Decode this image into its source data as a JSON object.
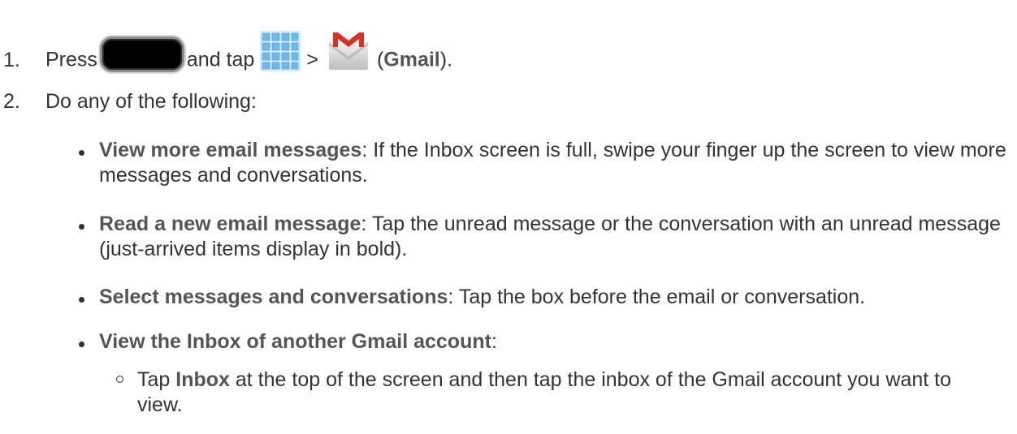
{
  "step1": {
    "number": "1.",
    "press": "Press",
    "and_tap": "and tap",
    "gt": ">",
    "paren_open": "(",
    "gmail_label": "Gmail",
    "paren_close": ")."
  },
  "step2": {
    "number": "2.",
    "text": "Do any of the following:"
  },
  "bullets": [
    {
      "title": "View more email messages",
      "text": ": If the Inbox screen is full, swipe your finger up the screen to view more messages and conversations."
    },
    {
      "title": "Read a new email message",
      "text": ": Tap the unread message or the conversation with an unread message (just-arrived items display in bold)."
    },
    {
      "title": "Select messages and conversations",
      "text": ": Tap the box before the email or conversation."
    },
    {
      "title": "View the Inbox of another Gmail account",
      "text": ":"
    }
  ],
  "sub_bullet": {
    "tap": "Tap ",
    "inbox": "Inbox",
    "text": " at the top of the screen and then tap the inbox of the Gmail account you want to view."
  },
  "icons": {
    "home_key": "home-key-icon",
    "apps": "apps-icon",
    "gmail": "gmail-icon"
  },
  "colors": {
    "text": "#333333",
    "apps_tile": "#7ec3ee",
    "gmail_red": "#d93025"
  }
}
